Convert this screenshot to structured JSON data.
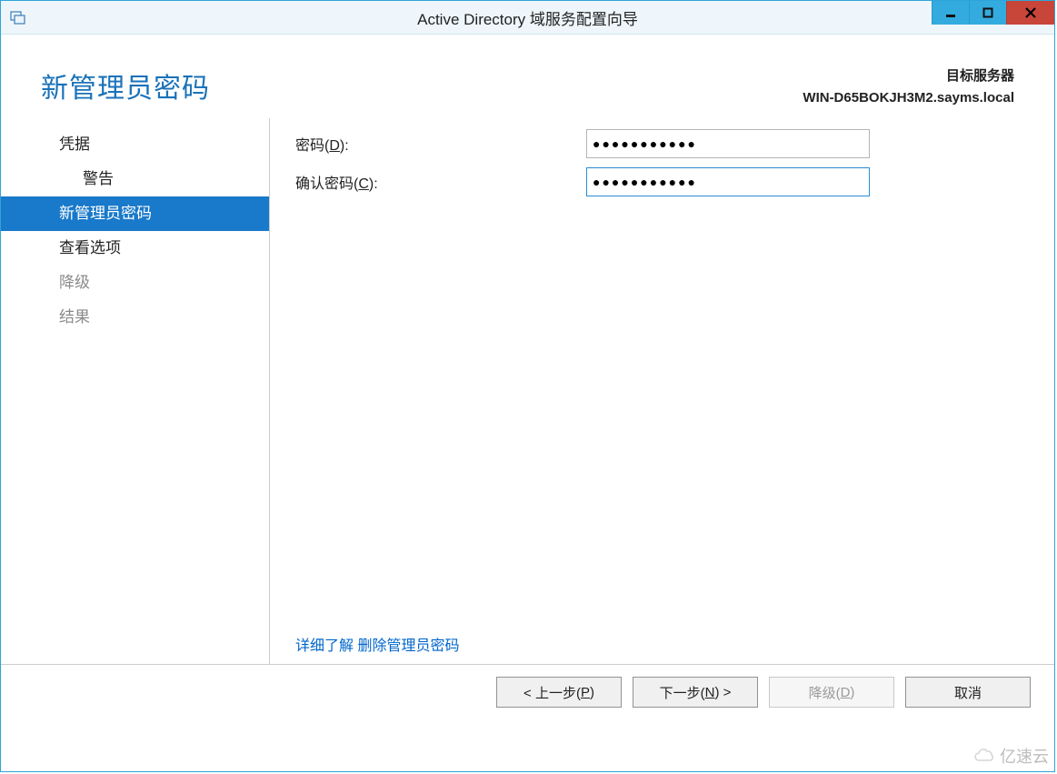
{
  "window": {
    "title": "Active Directory 域服务配置向导",
    "controls": {
      "minimize": "—",
      "maximize": "▢",
      "close": "X"
    }
  },
  "header": {
    "page_title": "新管理员密码",
    "target_label": "目标服务器",
    "target_server": "WIN-D65BOKJH3M2.sayms.local"
  },
  "sidebar": {
    "items": [
      {
        "label": "凭据",
        "level": 1,
        "state": "normal"
      },
      {
        "label": "警告",
        "level": 2,
        "state": "normal"
      },
      {
        "label": "新管理员密码",
        "level": 1,
        "state": "selected"
      },
      {
        "label": "查看选项",
        "level": 1,
        "state": "normal"
      },
      {
        "label": "降级",
        "level": 1,
        "state": "disabled"
      },
      {
        "label": "结果",
        "level": 1,
        "state": "disabled"
      }
    ]
  },
  "form": {
    "password_label_pre": "密码(",
    "password_accel": "D",
    "password_label_post": "):",
    "password_value": "●●●●●●●●●●●",
    "confirm_label_pre": "确认密码(",
    "confirm_accel": "C",
    "confirm_label_post": "):",
    "confirm_value": "●●●●●●●●●●●",
    "more_link": "详细了解 删除管理员密码"
  },
  "footer": {
    "prev_pre": "< 上一步(",
    "prev_accel": "P",
    "prev_post": ")",
    "next_pre": "下一步(",
    "next_accel": "N",
    "next_post": ") >",
    "demote_pre": "降级(",
    "demote_accel": "D",
    "demote_post": ")",
    "cancel": "取消"
  },
  "watermark": "亿速云"
}
